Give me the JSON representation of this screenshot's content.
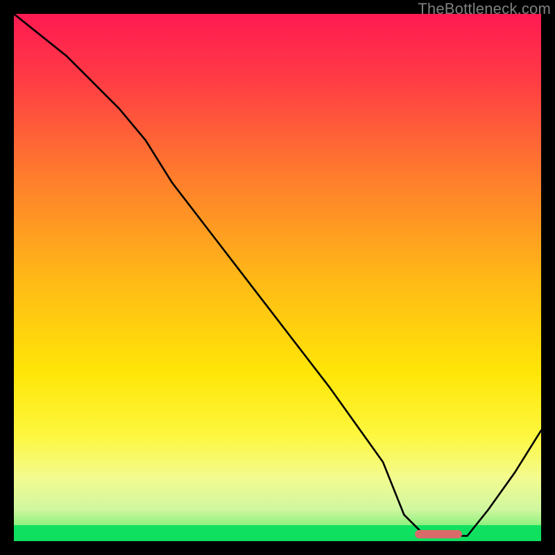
{
  "watermark": "TheBottleneck.com",
  "colors": {
    "frame": "#000000",
    "marker": "#d86a6a",
    "curve": "#000000",
    "green": "#10e060"
  },
  "chart_data": {
    "type": "line",
    "title": "",
    "xlabel": "",
    "ylabel": "",
    "xlim": [
      0,
      100
    ],
    "ylim": [
      0,
      100
    ],
    "gradient_stops": [
      {
        "pos": 0,
        "color": "#ff1a52"
      },
      {
        "pos": 12,
        "color": "#ff3a45"
      },
      {
        "pos": 30,
        "color": "#ff7a2e"
      },
      {
        "pos": 50,
        "color": "#ffb817"
      },
      {
        "pos": 68,
        "color": "#ffe607"
      },
      {
        "pos": 80,
        "color": "#fdf73f"
      },
      {
        "pos": 88,
        "color": "#f3fb8f"
      },
      {
        "pos": 94,
        "color": "#d0f7a0"
      },
      {
        "pos": 97,
        "color": "#8ef07f"
      },
      {
        "pos": 100,
        "color": "#10e060"
      }
    ],
    "green_band": {
      "y_from": 97,
      "y_to": 100
    },
    "marker_segment": {
      "x_from": 76,
      "x_to": 85,
      "y": 98.7
    },
    "series": [
      {
        "name": "bottleneck-curve",
        "x": [
          0,
          10,
          20,
          25,
          30,
          40,
          50,
          60,
          70,
          74,
          78,
          82,
          86,
          90,
          95,
          100
        ],
        "y": [
          100,
          92,
          82,
          76,
          68,
          55,
          42,
          29,
          15,
          5,
          1,
          1,
          1,
          6,
          13,
          21
        ]
      }
    ]
  }
}
